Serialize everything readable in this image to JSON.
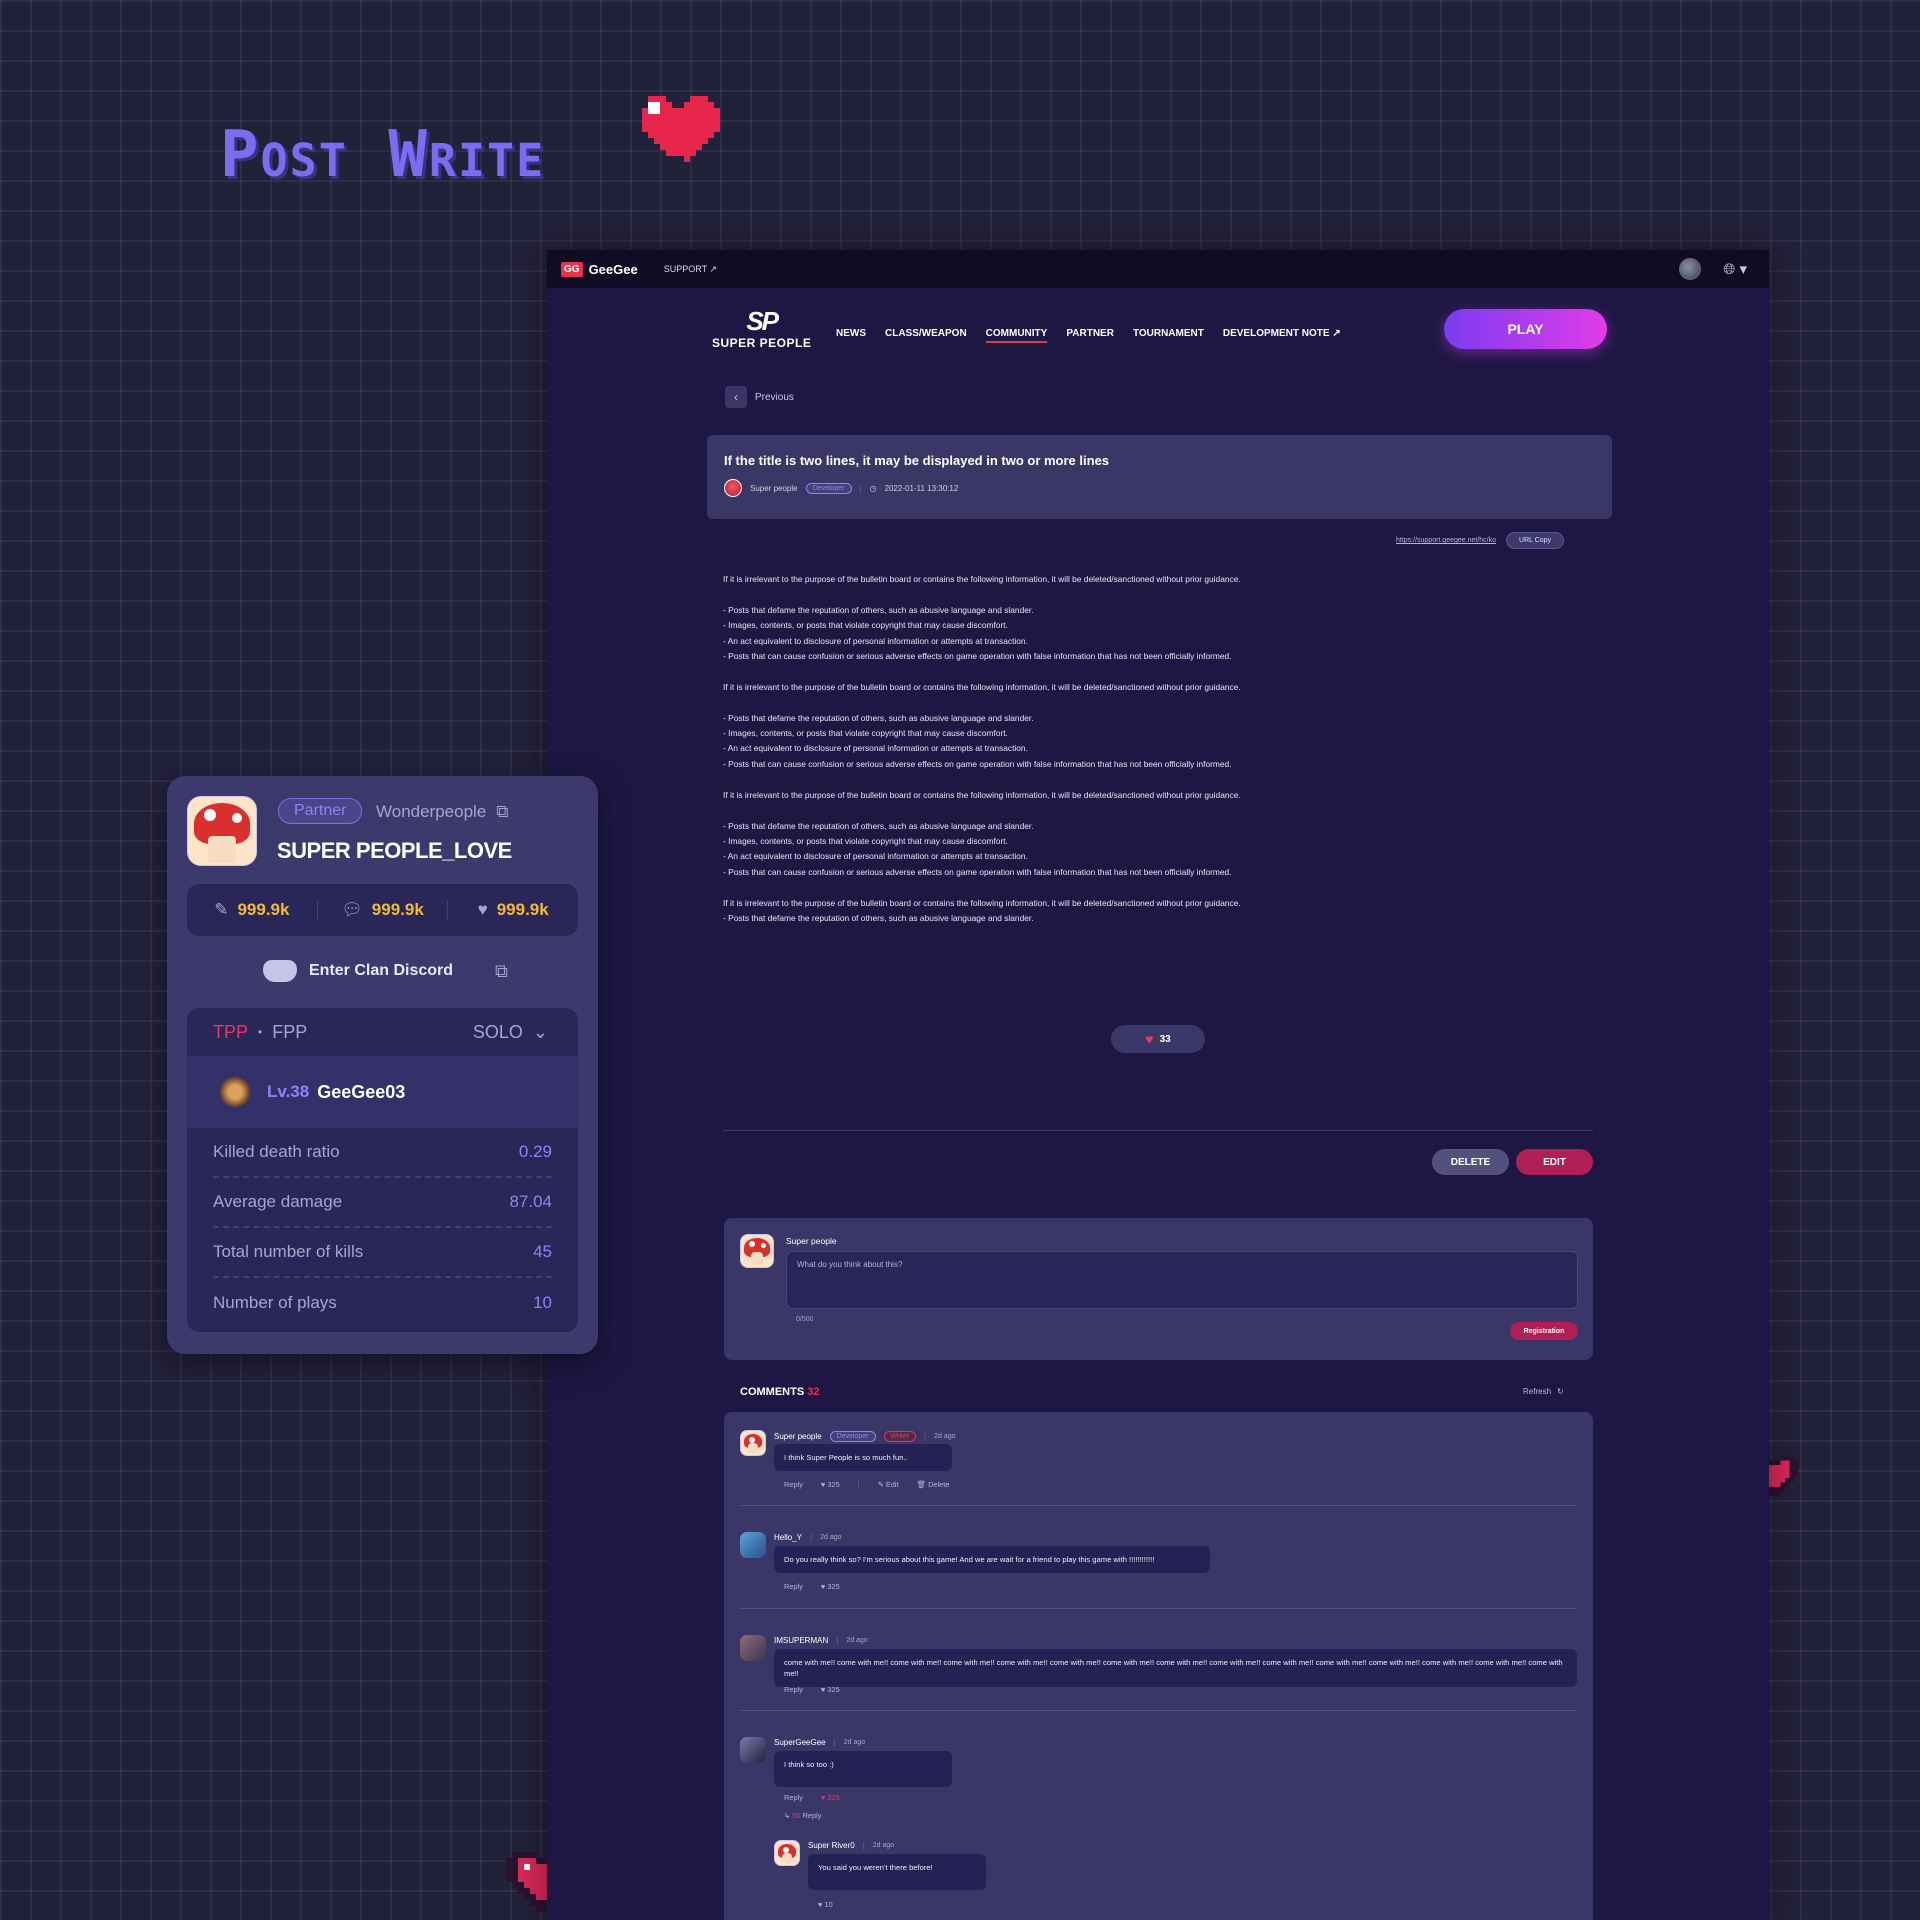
{
  "hero_title": "Post Write",
  "topbar": {
    "brand_box": "GG",
    "brand": "GeeGee",
    "support": "SUPPORT ↗"
  },
  "nav": {
    "logo_mark": "SP",
    "logo_name": "SUPER PEOPLE",
    "items": [
      "NEWS",
      "CLASS/WEAPON",
      "COMMUNITY",
      "PARTNER",
      "TOURNAMENT",
      "DEVELOPMENT NOTE ↗"
    ],
    "active_index": 2,
    "play": "PLAY"
  },
  "previous": "Previous",
  "post": {
    "title": "If the title is two lines, it may be displayed in two or more lines",
    "author": "Super people",
    "author_badge": "Developer",
    "datetime": "2022-01-11  13:30:12",
    "url": "https://support.geegee.net/hc/ko",
    "url_copy": "URL Copy",
    "body": "If it is irrelevant to the purpose of the bulletin board or contains the following information, it will be deleted/sanctioned without prior guidance.\n\n- Posts that defame the reputation of others, such as abusive language and slander.\n- Images, contents, or posts that violate copyright that may cause discomfort.\n- An act equivalent to disclosure of personal information or attempts at transaction.\n- Posts that can cause confusion or serious adverse effects on game operation with false information that has not been officially informed.\n\nIf it is irrelevant to the purpose of the bulletin board or contains the following information, it will be deleted/sanctioned without prior guidance.\n\n- Posts that defame the reputation of others, such as abusive language and slander.\n- Images, contents, or posts that violate copyright that may cause discomfort.\n- An act equivalent to disclosure of personal information or attempts at transaction.\n- Posts that can cause confusion or serious adverse effects on game operation with false information that has not been officially informed.\n\nIf it is irrelevant to the purpose of the bulletin board or contains the following information, it will be deleted/sanctioned without prior guidance.\n\n- Posts that defame the reputation of others, such as abusive language and slander.\n- Images, contents, or posts that violate copyright that may cause discomfort.\n- An act equivalent to disclosure of personal information or attempts at transaction.\n- Posts that can cause confusion or serious adverse effects on game operation with false information that has not been officially informed.\n\nIf it is irrelevant to the purpose of the bulletin board or contains the following information, it will be deleted/sanctioned without prior guidance.\n- Posts that defame the reputation of others, such as abusive language and slander.",
    "likes": "33",
    "delete": "DELETE",
    "edit": "EDIT"
  },
  "comment_form": {
    "user": "Super people",
    "placeholder": "What do you think about this?",
    "counter": "0/500",
    "submit": "Registration"
  },
  "comments_header": {
    "label": "COMMENTS",
    "count": "32",
    "refresh": "Refresh"
  },
  "comments": [
    {
      "user": "Super people",
      "badges": [
        "Developer",
        "Writer"
      ],
      "time": "2d ago",
      "text": "I think Super People is so much fun..",
      "reply": "Reply",
      "likes": "325",
      "edit": "Edit",
      "delete": "Delete"
    },
    {
      "user": "Hello_Y",
      "time": "2d ago",
      "text": "Do you really think so? I'm serious about this game! And we are wait for a friend to play this game with !!!!!!!!!!!!",
      "reply": "Reply",
      "likes": "325"
    },
    {
      "user": "IMSUPERMAN",
      "time": "2d ago",
      "text": "come with me!! come with me!! come with me!! come with me!! come with me!! come with me!! come with me!! come with me!! come with me!! come with me!! come with me!! come with me!! come with me!! come with me!! come with me!!",
      "reply": "Reply",
      "likes": "325"
    },
    {
      "user": "SuperGeeGee",
      "time": "2d ago",
      "text": "I think so too :)",
      "reply": "Reply",
      "likes": "325",
      "replies_count": "56",
      "replies_label": "Reply"
    },
    {
      "user": "Super River0",
      "time": "2d ago",
      "text": "You said you weren't there before!",
      "likes": "10"
    }
  ],
  "profile": {
    "badge": "Partner",
    "studio": "Wonderpeople",
    "name": "SUPER PEOPLE_LOVE",
    "posts": "999.9k",
    "comments": "999.9k",
    "likes": "999.9k",
    "discord": "Enter Clan Discord",
    "mode_a": "TPP",
    "mode_b": "FPP",
    "squad": "SOLO",
    "level": "Lv.38",
    "nickname": "GeeGee03",
    "stats": [
      {
        "label": "Killed death ratio",
        "value": "0.29"
      },
      {
        "label": "Average damage",
        "value": "87.04"
      },
      {
        "label": "Total number of kills",
        "value": "45"
      },
      {
        "label": "Number of plays",
        "value": "10"
      }
    ]
  },
  "colors": {
    "accent": "#e8334f",
    "purple": "#7b6df2",
    "gold": "#f2b937",
    "bg": "#22213a"
  }
}
